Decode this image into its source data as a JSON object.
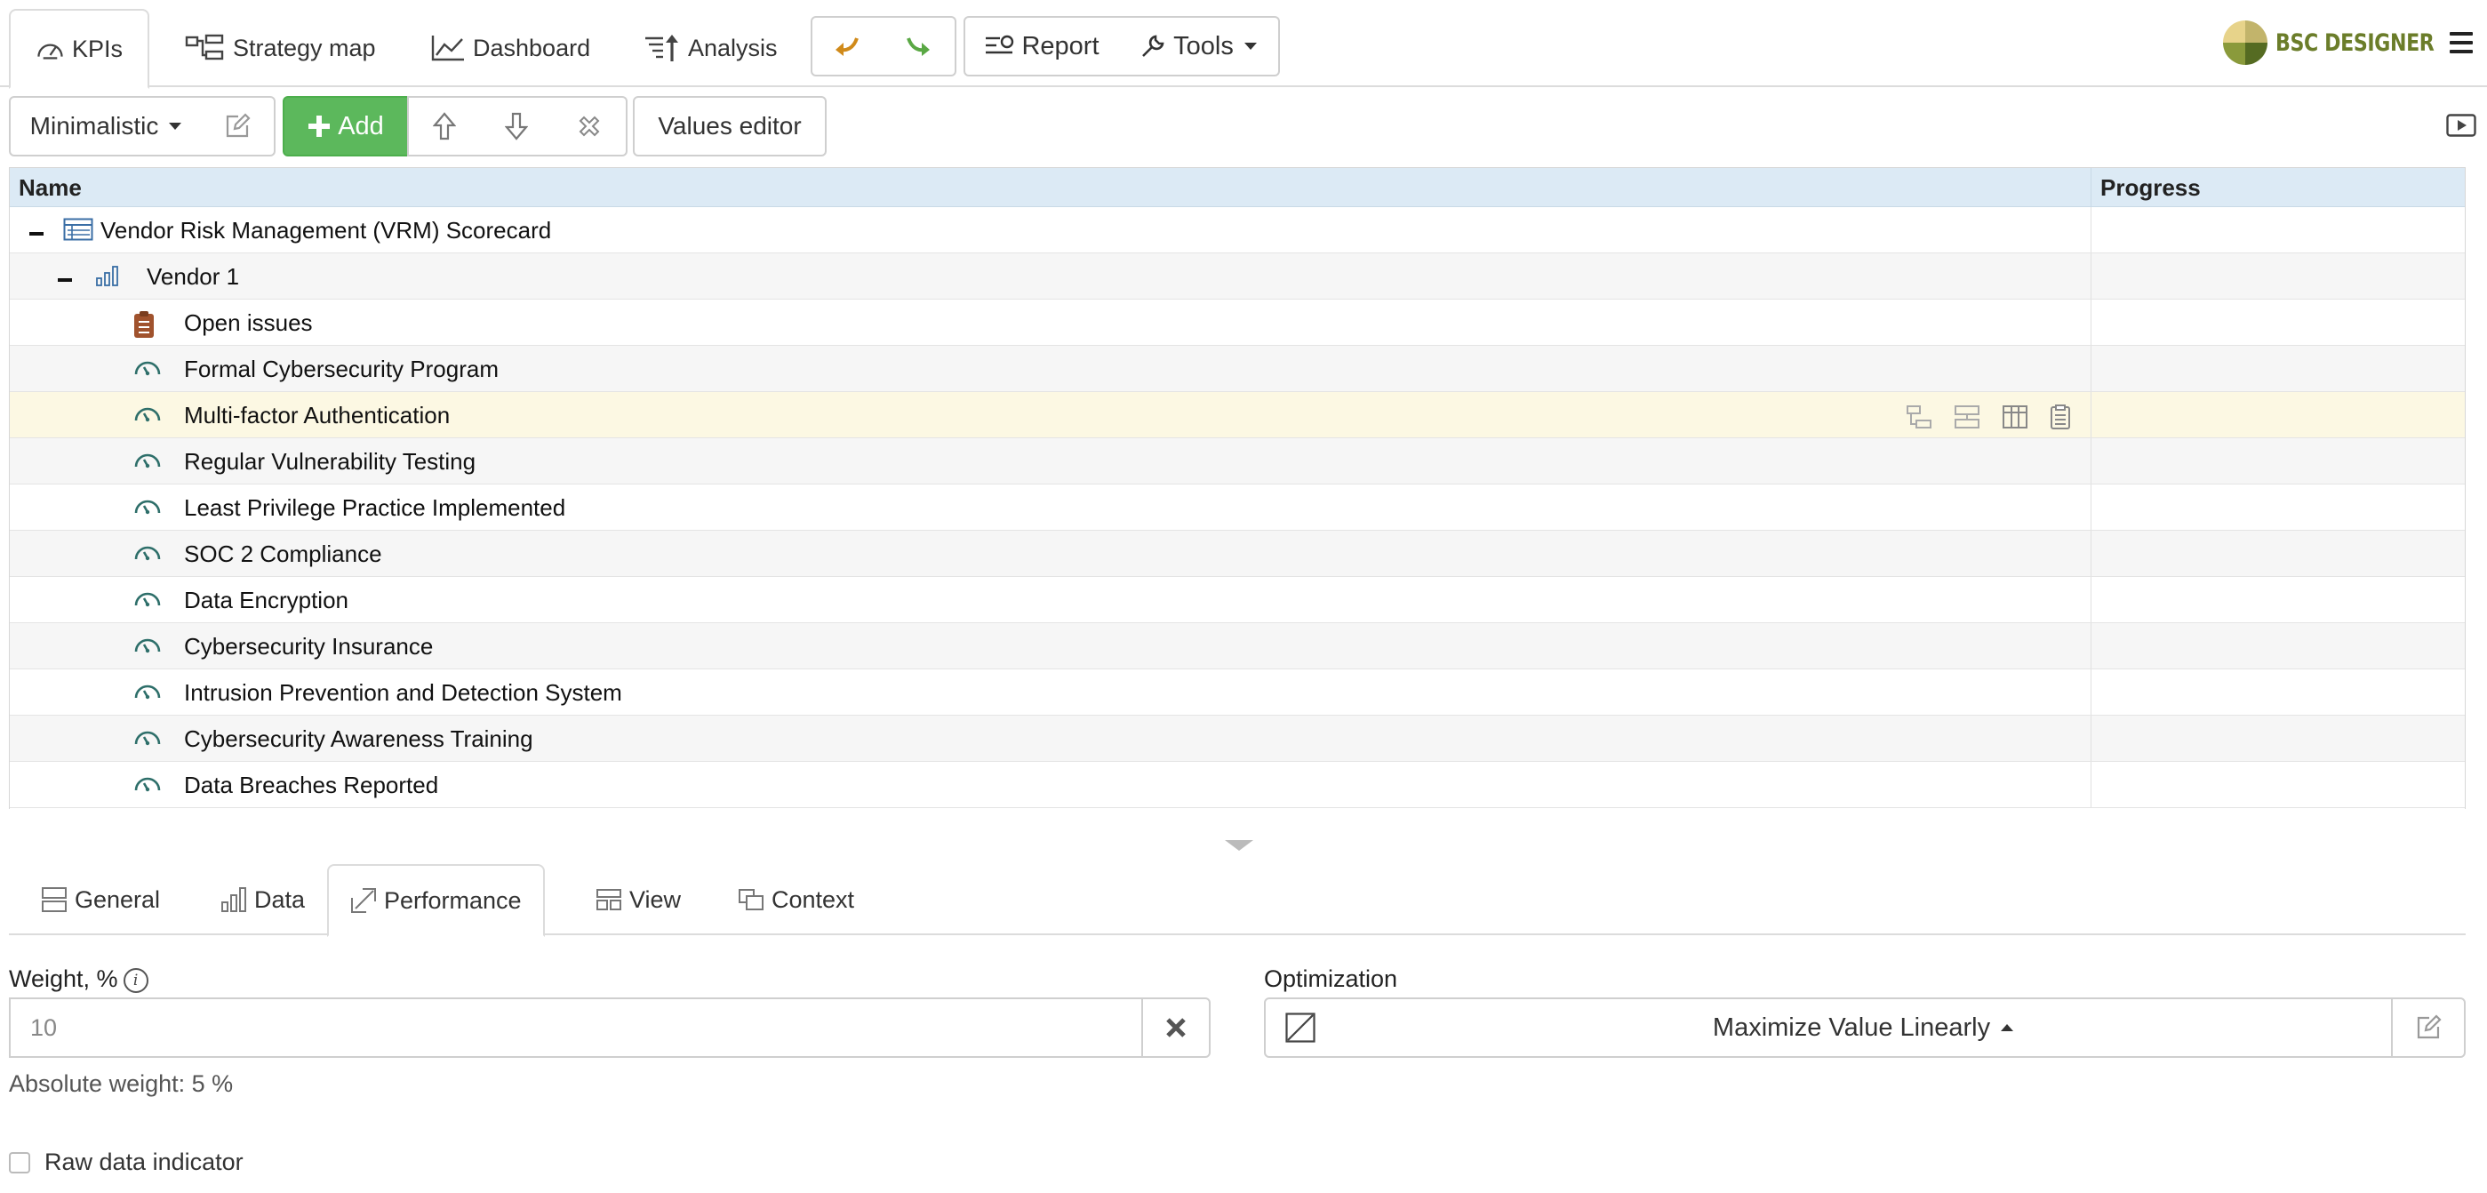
{
  "nav": {
    "tabs": [
      {
        "label": "KPIs",
        "icon": "gauge-icon",
        "active": true
      },
      {
        "label": "Strategy map",
        "icon": "strategy-map-icon"
      },
      {
        "label": "Dashboard",
        "icon": "line-chart-icon"
      },
      {
        "label": "Analysis",
        "icon": "analysis-icon"
      }
    ],
    "undo_icon": "undo-icon",
    "redo_icon": "redo-icon",
    "report_label": "Report",
    "tools_label": "Tools",
    "logo_text": "BSC DESIGNER"
  },
  "toolbar": {
    "view_label": "Minimalistic",
    "add_label": "Add",
    "values_editor_label": "Values editor"
  },
  "grid": {
    "columns": [
      "Name",
      "Progress"
    ],
    "rows": [
      {
        "label": "Vendor Risk Management (VRM) Scorecard",
        "icon": "scorecard-icon",
        "level": 0
      },
      {
        "label": "Vendor 1",
        "icon": "bar-chart-icon",
        "level": 1
      },
      {
        "label": "Open issues",
        "icon": "clipboard-icon",
        "level": 2
      },
      {
        "label": "Formal Cybersecurity Program",
        "icon": "gauge-icon",
        "level": 2
      },
      {
        "label": "Multi-factor Authentication",
        "icon": "gauge-icon",
        "level": 2,
        "selected": true
      },
      {
        "label": "Regular Vulnerability Testing",
        "icon": "gauge-icon",
        "level": 2
      },
      {
        "label": "Least Privilege Practice Implemented",
        "icon": "gauge-icon",
        "level": 2
      },
      {
        "label": "SOC 2 Compliance",
        "icon": "gauge-icon",
        "level": 2
      },
      {
        "label": "Data Encryption",
        "icon": "gauge-icon",
        "level": 2
      },
      {
        "label": "Cybersecurity Insurance",
        "icon": "gauge-icon",
        "level": 2
      },
      {
        "label": "Intrusion Prevention and Detection System",
        "icon": "gauge-icon",
        "level": 2
      },
      {
        "label": "Cybersecurity Awareness Training",
        "icon": "gauge-icon",
        "level": 2
      },
      {
        "label": "Data Breaches Reported",
        "icon": "gauge-icon",
        "level": 2
      }
    ]
  },
  "details": {
    "tabs": [
      {
        "label": "General"
      },
      {
        "label": "Data"
      },
      {
        "label": "Performance",
        "active": true
      },
      {
        "label": "View"
      },
      {
        "label": "Context"
      }
    ],
    "weight_label": "Weight, %",
    "weight_placeholder": "10",
    "absolute_weight": "Absolute weight: 5 %",
    "optimization_label": "Optimization",
    "optimization_value": "Maximize Value Linearly",
    "raw_data_label": "Raw data indicator"
  },
  "colors": {
    "accent_green": "#5cb85c",
    "header_blue": "#dceaf5",
    "selected_row": "#fcf8e3",
    "gauge_teal": "#2e6f6a",
    "undo_orange": "#d08a1a",
    "redo_green": "#5aa844"
  }
}
